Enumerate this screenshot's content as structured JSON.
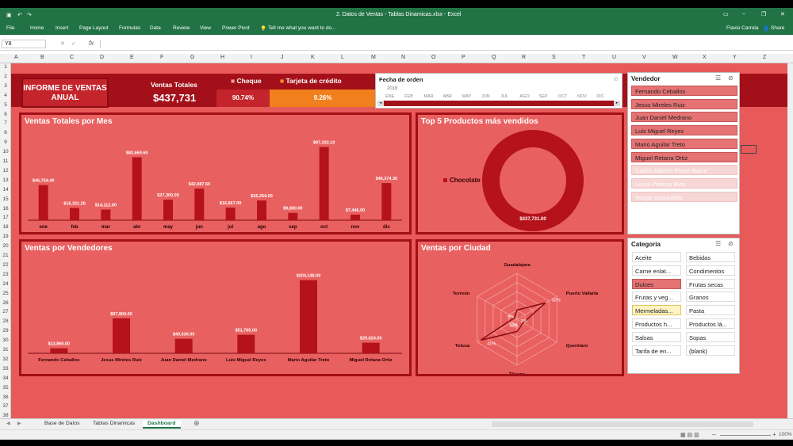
{
  "app": {
    "title": "2. Datos de Ventas - Tablas Dinamicas.xlsx - Excel",
    "user": "Flavio Carrola",
    "share": "Share",
    "tell_me": "Tell me what you want to do..."
  },
  "ribbon": [
    "File",
    "Home",
    "Insert",
    "Page Layout",
    "Formulas",
    "Data",
    "Review",
    "View",
    "Power Pivot"
  ],
  "formula": {
    "namebox": "Y8",
    "fx": "fx"
  },
  "columns": [
    "A",
    "B",
    "C",
    "D",
    "E",
    "F",
    "G",
    "H",
    "I",
    "J",
    "K",
    "L",
    "M",
    "N",
    "O",
    "P",
    "Q",
    "R",
    "S",
    "T",
    "U",
    "V",
    "W",
    "X",
    "Y",
    "Z"
  ],
  "rows": [
    "1",
    "2",
    "3",
    "4",
    "5",
    "6",
    "7",
    "8",
    "9",
    "10",
    "11",
    "12",
    "13",
    "14",
    "15",
    "16",
    "17",
    "18",
    "19",
    "20",
    "21",
    "22",
    "23",
    "24",
    "25",
    "26",
    "27",
    "28",
    "29",
    "30",
    "31",
    "32",
    "33",
    "34",
    "35",
    "36",
    "37",
    "38"
  ],
  "header": {
    "title_l1": "INFORME DE VENTAS",
    "title_l2": "ANUAL",
    "total_label": "Ventas Totales",
    "total_value": "$437,731",
    "cheque_label": "Cheque",
    "cheque_value": "90.74%",
    "tarjeta_label": "Tarjeta de crédito",
    "tarjeta_value": "9.26%"
  },
  "timeline": {
    "title": "Fecha de orden",
    "year": "2018",
    "months": [
      "ENE",
      "FEB",
      "MAR",
      "ABR",
      "MAY",
      "JUN",
      "JUL",
      "AGO",
      "SEP",
      "OCT",
      "NOV",
      "DIC"
    ]
  },
  "vendedor": {
    "title": "Vendedor",
    "items": [
      "Fernando Ceballos",
      "Jesus Mireles Ruiz",
      "Juan Daniel Medrano",
      "Luis Miguel Reyes",
      "Mario Aguilar Treto",
      "Miguel Retana Ortiz",
      "Carlos Alberto Perez Ibarra",
      "Laura Patricia Rios",
      "Sergio Sepulveda"
    ],
    "selected_count": 6
  },
  "categoria": {
    "title": "Categoria",
    "items": [
      "Aceite",
      "Bebidas",
      "Carne enlat...",
      "Condimentos",
      "Dulces",
      "Frutas secas",
      "Frutas y veg...",
      "Granos",
      "Mermeladas...",
      "Pasta",
      "Productos h...",
      "Productos lá...",
      "Salsas",
      "Sopas",
      "Tarifa de en...",
      "(blank)"
    ],
    "selected": "Dulces",
    "hover": "Mermeladas..."
  },
  "sheets": {
    "tabs": [
      "Base de Datos",
      "Tablas Dinamicas",
      "Dashboard"
    ],
    "active": "Dashboard"
  },
  "status": {
    "zoom": "100%"
  },
  "panel_titles": {
    "mes": "Ventas Totales por Mes",
    "top5": "Top 5 Productos más vendidos",
    "vend": "Ventas por Vendedores",
    "ciudad": "Ventas por Ciudad"
  },
  "chart_data": [
    {
      "type": "bar",
      "title": "Ventas Totales por Mes",
      "categories": [
        "ene",
        "feb",
        "mar",
        "abr",
        "may",
        "jun",
        "jul",
        "ago",
        "sep",
        "oct",
        "nov",
        "dic"
      ],
      "values": [
        46754.4,
        16321.2,
        14112.0,
        83669.6,
        27300.0,
        42087.6,
        16667.0,
        26264.0,
        9800.0,
        97332.1,
        7446.0,
        49374.3
      ],
      "labels": [
        "$46,754.40",
        "$16,321.20",
        "$14,112.00",
        "$83,669.60",
        "$27,300.00",
        "$42,087.60",
        "$16,667.00",
        "$26,264.00",
        "$9,800.00",
        "$97,332.10",
        "$7,446.00",
        "$49,374.30"
      ]
    },
    {
      "type": "pie",
      "title": "Top 5 Productos más vendidos",
      "categories": [
        "Chocolate"
      ],
      "values": [
        437731.0
      ],
      "labels": [
        "$437,731.00"
      ],
      "legend": "Chocolate"
    },
    {
      "type": "bar",
      "title": "Ventas por Vendedores",
      "categories": [
        "Fernando Ceballos",
        "Jesus Mireles Ruiz",
        "Juan Daniel Medrano",
        "Luis Miguel Reyes",
        "Mario Aguilar Treto",
        "Miguel Retana Ortiz"
      ],
      "values": [
        13860.0,
        97804.0,
        40530.0,
        51765.0,
        204148.0,
        29624.0
      ],
      "labels": [
        "$13,860.00",
        "$97,804.00",
        "$40,530.00",
        "$51,765.00",
        "$204,148.00",
        "$29,624.00"
      ]
    },
    {
      "type": "radar",
      "title": "Ventas por Ciudad",
      "categories": [
        "Guadalajara",
        "Puerto Vallarta",
        "Querétaro",
        "Tijuana",
        "Toluca",
        "Torreón"
      ],
      "values": [
        9,
        32,
        7,
        12,
        41,
        3
      ],
      "labels": [
        "9%",
        "32%",
        "7%",
        "12%",
        "41%",
        "3%"
      ]
    }
  ]
}
